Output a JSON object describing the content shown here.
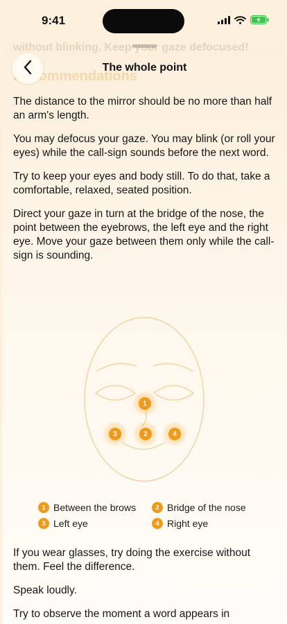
{
  "status": {
    "time": "9:41"
  },
  "sheet": {
    "ghost_text": "without blinking. Keep your gaze defocused!",
    "ghost_heading": "Recommendations",
    "title": "The whole point"
  },
  "paragraphs_top": [
    "The distance to the mirror should be no more than half an arm's length.",
    "You may defocus your gaze. You may blink (or roll your eyes) while the call-sign sounds before the next word.",
    "Try to keep your eyes and body still. To do that, take a comfortable, relaxed, seated position.",
    "Direct your gaze in turn at the bridge of the nose, the point between the eyebrows, the left eye and the right eye. Move your gaze between them only while the call-sign is sounding."
  ],
  "diagram": {
    "badges": [
      "1",
      "2",
      "3",
      "4"
    ]
  },
  "legend": [
    {
      "num": "1",
      "label": "Between the brows"
    },
    {
      "num": "2",
      "label": "Bridge of the nose"
    },
    {
      "num": "3",
      "label": "Left eye"
    },
    {
      "num": "4",
      "label": "Right eye"
    }
  ],
  "paragraphs_bottom": [
    "If you wear glasses, try doing the exercise without them. Feel the difference.",
    "Speak loudly.",
    "Try to observe the moment a word appears in"
  ],
  "colors": {
    "accent": "#ef9a1a",
    "background": "#fdf1de"
  }
}
